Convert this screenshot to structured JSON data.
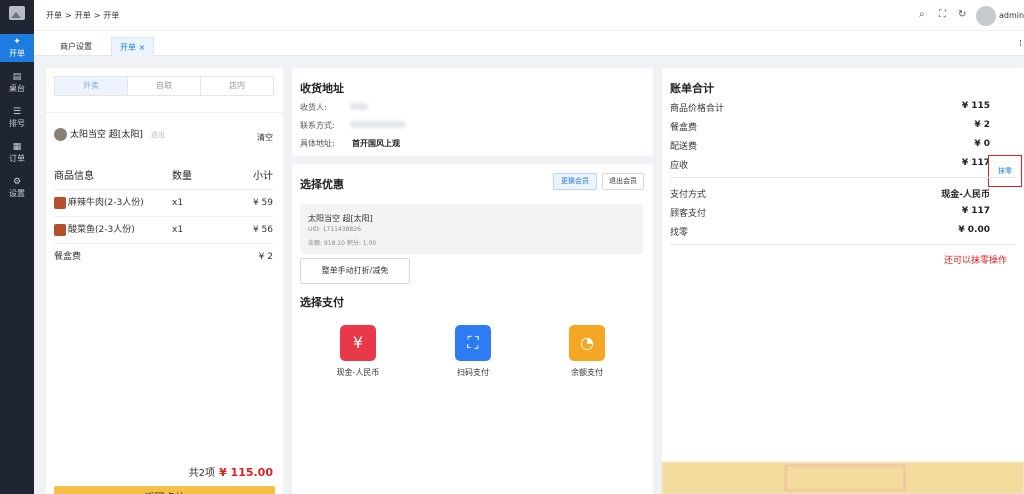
{
  "nav": {
    "items": [
      {
        "icon": "✦",
        "label": "开单"
      },
      {
        "icon": "▤",
        "label": "桌台"
      },
      {
        "icon": "☰",
        "label": "排号"
      },
      {
        "icon": "▦",
        "label": "订单"
      },
      {
        "icon": "⚙",
        "label": "设置"
      }
    ]
  },
  "breadcrumb": [
    "开单",
    ">",
    "开单",
    ">",
    "开单"
  ],
  "header": {
    "user": "admin"
  },
  "tabs": [
    {
      "label": "商户设置"
    },
    {
      "label": "开单",
      "close": "×"
    }
  ],
  "left": {
    "modes": [
      "外卖",
      "自取",
      "店内"
    ],
    "member_name": "太阳当空 超[太阳]",
    "member_exit": "退出",
    "clear": "清空",
    "columns": [
      "商品信息",
      "数量",
      "小计"
    ],
    "items": [
      {
        "name": "麻辣牛肉(2-3人份)",
        "qty": "x1",
        "subtotal": "¥ 59"
      },
      {
        "name": "酸菜鱼(2-3人份)",
        "qty": "x1",
        "subtotal": "¥ 56"
      }
    ],
    "box_fee_label": "餐盒费",
    "box_fee": "¥ 2",
    "count": "共2项",
    "total": "¥ 115.00",
    "back_button": "返回点单"
  },
  "address": {
    "title": "收货地址",
    "receiver_label": "收货人:",
    "phone_label": "联系方式:",
    "detail_label": "具体地址:",
    "detail": "首开国风上观"
  },
  "discount": {
    "title": "选择优惠",
    "change_member": "更换会员",
    "exit_member": "退出会员",
    "member_name": "太阳当空 超[太阳]",
    "uid": "UID: 1711438826",
    "balance": "余额: 918.10    积分: 1.00",
    "manual_button": "整单手动打折/减免"
  },
  "payment": {
    "title": "选择支付",
    "methods": [
      {
        "label": "现金-人民币",
        "icon": "¥",
        "color": "#e8394a"
      },
      {
        "label": "扫码支付",
        "icon": "⛶",
        "color": "#2d7cf6"
      },
      {
        "label": "余额支付",
        "icon": "◔",
        "color": "#f5a623"
      }
    ]
  },
  "bill": {
    "title": "账单合计",
    "rows": [
      {
        "label": "商品价格合计",
        "value": "¥ 115"
      },
      {
        "label": "餐盒费",
        "value": "¥ 2"
      },
      {
        "label": "配送费",
        "value": "¥ 0"
      },
      {
        "label": "应收",
        "value": "¥ 117"
      }
    ],
    "moling": "抹零",
    "rows2": [
      {
        "label": "支付方式",
        "value": "现金-人民币"
      },
      {
        "label": "顾客支付",
        "value": "¥ 117"
      },
      {
        "label": "找零",
        "value": "¥ 0.00"
      }
    ],
    "note": "还可以抹零操作"
  }
}
